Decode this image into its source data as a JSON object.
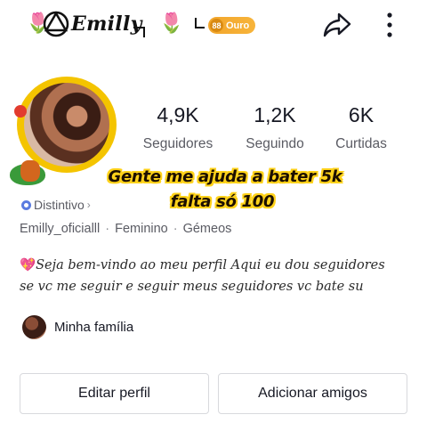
{
  "header": {
    "display_name": "Emilly",
    "badge_label": "Ouro",
    "icons": [
      "rose-icon",
      "logo-mark-icon",
      "rose-icon",
      "ouro-badge-icon",
      "share-icon",
      "more-icon"
    ]
  },
  "stats": [
    {
      "value": "4,9K",
      "label": "Seguidores"
    },
    {
      "value": "1,2K",
      "label": "Seguindo"
    },
    {
      "value": "6K",
      "label": "Curtidas"
    }
  ],
  "overlay": {
    "line1": "Gente me ajuda a bater 5k",
    "line2": "falta só 100"
  },
  "profile": {
    "distintivo": "Distintivo",
    "username": "Emilly_oficialll",
    "gender": "Feminino",
    "sign": "Gémeos",
    "bio_line1": "Seja bem-vindo ao meu perfil Aqui eu dou seguidores",
    "bio_line2": "se vc me seguir e seguir meus seguidores vc bate su",
    "family_label": "Minha família"
  },
  "actions": {
    "edit_label": "Editar perfil",
    "add_label": "Adicionar amigos"
  },
  "colors": {
    "overlay_outline": "#ffd21a",
    "badge": "#f2a52a",
    "distintivo_icon": "#5a7be0"
  }
}
